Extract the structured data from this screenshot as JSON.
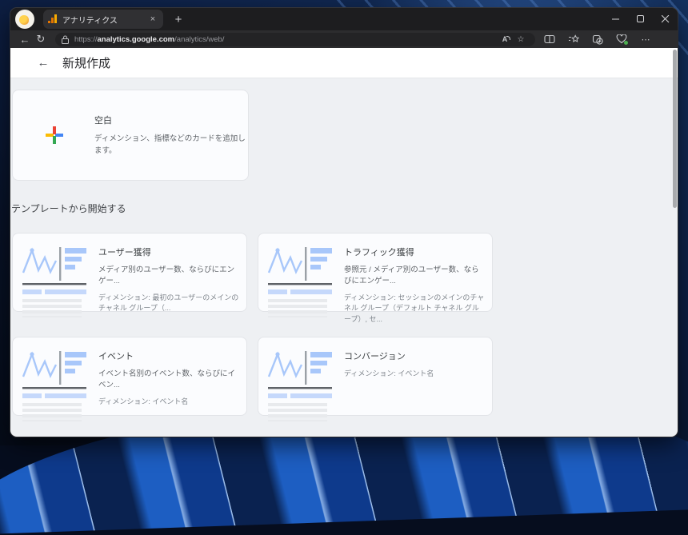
{
  "browser": {
    "tab": {
      "title": "アナリティクス"
    },
    "glyphs": {
      "close": "×",
      "new_tab": "+",
      "back": "←",
      "refresh": "↻",
      "read_aloud": "A",
      "favorite_star": "☆",
      "more": "⋯"
    },
    "address": {
      "scheme": "https://",
      "host": "analytics.google.com",
      "path": "/analytics/web/"
    },
    "icons": {
      "favicon": "analytics-orange-bars",
      "browser_essentials_status_color": "#4caf50",
      "analytics_orange": "#f9ab00",
      "analytics_dark_orange": "#e37400"
    }
  },
  "page": {
    "header": {
      "back": "←",
      "title": "新規作成"
    },
    "blank_card": {
      "title": "空白",
      "description": "ディメンション、指標などのカードを追加します。",
      "plus_colors": {
        "top": "#ea4335",
        "bottom": "#34a853",
        "left": "#fbbc04",
        "right": "#4285f4"
      }
    },
    "section_label": "テンプレートから開始する",
    "templates": [
      {
        "title": "ユーザー獲得",
        "description": "メディア別のユーザー数、ならびにエンゲー...",
        "dimensions": "ディメンション: 最初のユーザーのメインのチャネル グループ（..."
      },
      {
        "title": "トラフィック獲得",
        "description": "参照元 / メディア別のユーザー数、ならびにエンゲー...",
        "dimensions": "ディメンション: セッションのメインのチャネル グループ（デフォルト チャネル グループ）, セ..."
      },
      {
        "title": "イベント",
        "description": "イベント名別のイベント数、ならびにイベン...",
        "dimensions": "ディメンション: イベント名"
      },
      {
        "title": "コンバージョン",
        "description": "",
        "dimensions": "ディメンション: イベント名"
      }
    ],
    "colors": {
      "page_bg": "#eef0f3",
      "card_bg": "#fbfcfe",
      "thumb_blue": "#a8c7fa",
      "thumb_light_blue": "#c5d8fb",
      "thumb_gray": "#e8eaed"
    }
  }
}
